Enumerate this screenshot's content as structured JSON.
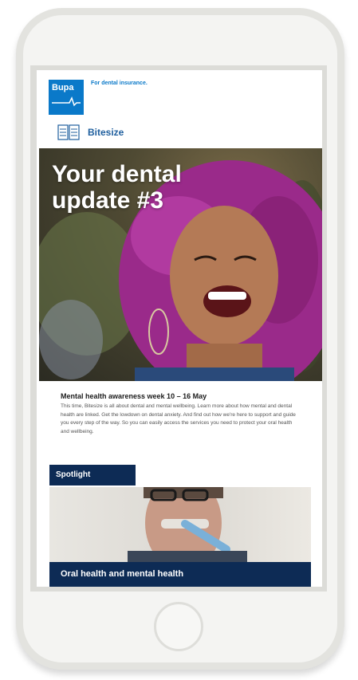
{
  "header": {
    "logo_text": "Bupa",
    "tagline": "For dental insurance.",
    "section_label": "Bitesize"
  },
  "hero": {
    "title": "Your dental update #3"
  },
  "article": {
    "title": "Mental health awareness week 10 – 16 May",
    "body": "This time, Bitesize is all about dental and mental wellbeing. Learn more about how mental and dental health are linked. Get the lowdown on dental anxiety. And find out how we're here to support and guide you every step of the way. So you can easily access the services you need to protect your oral health and wellbeing."
  },
  "spotlight": {
    "label": "Spotlight",
    "feature_title": "Oral health and mental health"
  },
  "colors": {
    "brand_blue": "#0a79c9",
    "navy": "#0d2b55"
  }
}
